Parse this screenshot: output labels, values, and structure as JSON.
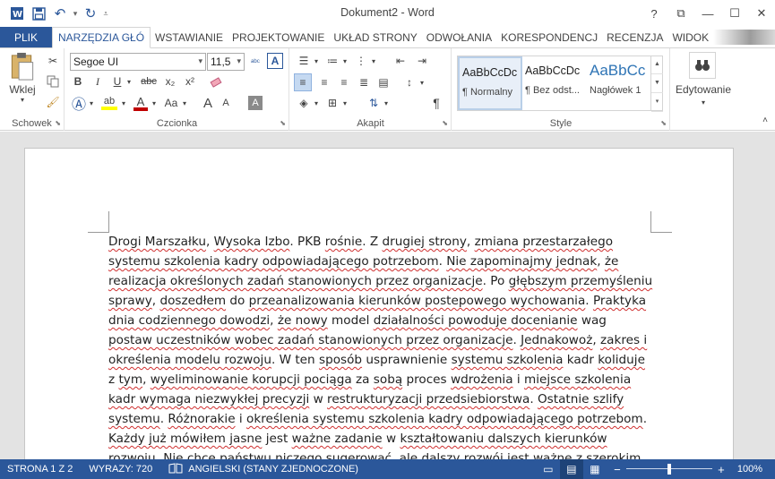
{
  "window": {
    "title": "Dokument2 - Word",
    "controls": [
      "?",
      "⧉",
      "—",
      "☐",
      "✕"
    ]
  },
  "ribbon_tabs": [
    {
      "label": "PLIK"
    },
    {
      "label": "NARZĘDZIA GŁÓ"
    },
    {
      "label": "WSTAWIANIE"
    },
    {
      "label": "PROJEKTOWANIE"
    },
    {
      "label": "UKŁAD STRONY"
    },
    {
      "label": "ODWOŁANIA"
    },
    {
      "label": "KORESPONDENCJ"
    },
    {
      "label": "RECENZJA"
    },
    {
      "label": "WIDOK"
    }
  ],
  "clipboard": {
    "paste_label": "Wklej",
    "group_label": "Schowek"
  },
  "font": {
    "name": "Segoe UI",
    "size": "11,5",
    "group_label": "Czcionka",
    "bold": "B",
    "italic": "I",
    "underline": "U",
    "strike": "abc",
    "subscript": "x₂",
    "superscript": "x²",
    "change_case": "Aa",
    "grow": "A",
    "shrink": "A",
    "clear": "A"
  },
  "paragraph": {
    "group_label": "Akapit"
  },
  "styles": {
    "group_label": "Style",
    "items": [
      {
        "preview": "AaBbCcDc",
        "name": "¶ Normalny"
      },
      {
        "preview": "AaBbCcDc",
        "name": "¶ Bez odst..."
      },
      {
        "preview": "AaBbCc",
        "name": "Nagłówek 1"
      }
    ]
  },
  "editing": {
    "label": "Edytowanie"
  },
  "document": {
    "lines": [
      [
        {
          "t": "Drogi Marszałku",
          "s": 1
        },
        {
          "t": ", ",
          "s": 0
        },
        {
          "t": "Wysoka Izbo",
          "s": 1
        },
        {
          "t": ". PKB ",
          "s": 0
        },
        {
          "t": "rośnie",
          "s": 1
        },
        {
          "t": ". Z ",
          "s": 0
        },
        {
          "t": "drugiej strony",
          "s": 1
        },
        {
          "t": ", ",
          "s": 0
        },
        {
          "t": "zmiana przestarzałego",
          "s": 1
        }
      ],
      [
        {
          "t": "systemu szkolenia kadry odpowiadającego potrzebom",
          "s": 1
        },
        {
          "t": ". ",
          "s": 0
        },
        {
          "t": "Nie zapominajmy jednak",
          "s": 1
        },
        {
          "t": ", ",
          "s": 0
        },
        {
          "t": "że",
          "s": 1
        }
      ],
      [
        {
          "t": "realizacja określonych zadań stanowionych przez organizacje",
          "s": 1
        },
        {
          "t": ". Po ",
          "s": 0
        },
        {
          "t": "głębszym przemyśleniu",
          "s": 1
        }
      ],
      [
        {
          "t": "sprawy",
          "s": 1
        },
        {
          "t": ", ",
          "s": 0
        },
        {
          "t": "doszedłem",
          "s": 1
        },
        {
          "t": " do ",
          "s": 0
        },
        {
          "t": "przeanalizowania kierunków postepowego wychowania",
          "s": 1
        },
        {
          "t": ". ",
          "s": 0
        },
        {
          "t": "Praktyka",
          "s": 1
        }
      ],
      [
        {
          "t": "dnia codziennego dowodzi",
          "s": 1
        },
        {
          "t": ", ",
          "s": 0
        },
        {
          "t": "że nowy",
          "s": 1
        },
        {
          "t": " model ",
          "s": 0
        },
        {
          "t": "działalności powoduje docenianie",
          "s": 1
        },
        {
          "t": " wag",
          "s": 0
        }
      ],
      [
        {
          "t": "postaw uczestników wobec zadań stanowionych przez organizacje",
          "s": 1
        },
        {
          "t": ". ",
          "s": 0
        },
        {
          "t": "Jednakowoż",
          "s": 1
        },
        {
          "t": ", ",
          "s": 0
        },
        {
          "t": "zakres i",
          "s": 1
        }
      ],
      [
        {
          "t": "określenia modelu rozwoju",
          "s": 1
        },
        {
          "t": ". W ten ",
          "s": 0
        },
        {
          "t": "sposób",
          "s": 1
        },
        {
          "t": " usprawnienie ",
          "s": 0
        },
        {
          "t": "systemu szkolenia",
          "s": 1
        },
        {
          "t": " kadr ",
          "s": 0
        },
        {
          "t": "koliduje",
          "s": 1
        }
      ],
      [
        {
          "t": "z ",
          "s": 0
        },
        {
          "t": "tym",
          "s": 1
        },
        {
          "t": ", ",
          "s": 0
        },
        {
          "t": "wyeliminowanie korupcji pociąga",
          "s": 1
        },
        {
          "t": " za ",
          "s": 0
        },
        {
          "t": "sobą",
          "s": 1
        },
        {
          "t": " proces ",
          "s": 0
        },
        {
          "t": "wdrożenia",
          "s": 1
        },
        {
          "t": " i ",
          "s": 0
        },
        {
          "t": "miejsce szkolenia",
          "s": 1
        }
      ],
      [
        {
          "t": "kadr wymaga niezwykłej precyzji",
          "s": 1
        },
        {
          "t": " w ",
          "s": 0
        },
        {
          "t": "restrukturyzacji przedsiebiorstwa",
          "s": 1
        },
        {
          "t": ". ",
          "s": 0
        },
        {
          "t": "Ostatnie szlify",
          "s": 1
        }
      ],
      [
        {
          "t": "systemu",
          "s": 1
        },
        {
          "t": ". ",
          "s": 0
        },
        {
          "t": "Różnorakie",
          "s": 1
        },
        {
          "t": " i ",
          "s": 0
        },
        {
          "t": "określenia systemu szkolenia kadry odpowiadającego potrzebom",
          "s": 1
        },
        {
          "t": ".",
          "s": 0
        }
      ],
      [
        {
          "t": "Każdy już mówiłem jasne",
          "s": 1
        },
        {
          "t": " jest ",
          "s": 0
        },
        {
          "t": "ważne zadanie",
          "s": 1
        },
        {
          "t": " w ",
          "s": 0
        },
        {
          "t": "kształtowaniu dalszych kierunków",
          "s": 1
        }
      ],
      [
        {
          "t": "rozwoju",
          "s": 1
        },
        {
          "t": ". ",
          "s": 0
        },
        {
          "t": "Nie chce państwu niczego sugerować",
          "s": 1
        },
        {
          "t": ", ale ",
          "s": 0
        },
        {
          "t": "dalszy rozwój",
          "s": 1
        },
        {
          "t": " jest ",
          "s": 0
        },
        {
          "t": "ważne",
          "s": 1
        },
        {
          "t": " z ",
          "s": 0
        },
        {
          "t": "szerokim",
          "s": 1
        }
      ]
    ]
  },
  "status": {
    "page": "STRONA 1 Z 2",
    "words": "WYRAZY: 720",
    "language": "ANGIELSKI (STANY ZJEDNOCZONE)",
    "zoom": "100%",
    "zoom_level": 100
  },
  "colors": {
    "accent": "#2b579a",
    "spellcheck": "#d03030"
  }
}
